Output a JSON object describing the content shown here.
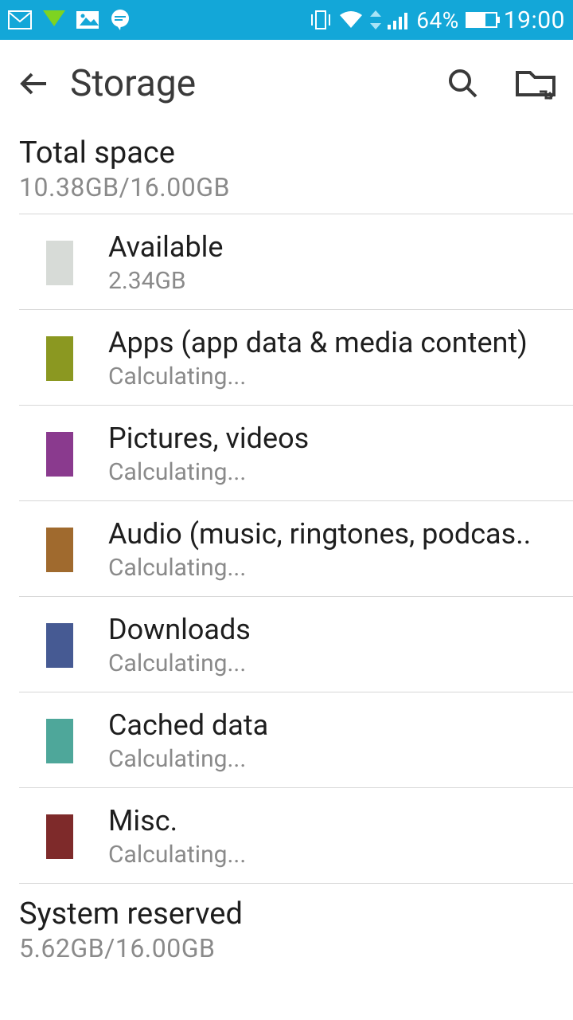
{
  "status": {
    "battery_pct": "64%",
    "time": "19:00"
  },
  "header": {
    "title": "Storage"
  },
  "total": {
    "label": "Total space",
    "value": "10.38GB/16.00GB"
  },
  "rows": [
    {
      "name": "available",
      "color": "#d7dbd7",
      "title": "Available",
      "sub": "2.34GB"
    },
    {
      "name": "apps",
      "color": "#8b9821",
      "title": "Apps (app data & media content)",
      "sub": "Calculating..."
    },
    {
      "name": "pictures",
      "color": "#8a3a8e",
      "title": "Pictures, videos",
      "sub": "Calculating..."
    },
    {
      "name": "audio",
      "color": "#a06a2e",
      "title": "Audio (music, ringtones, podcas..",
      "sub": "Calculating..."
    },
    {
      "name": "downloads",
      "color": "#465a93",
      "title": "Downloads",
      "sub": "Calculating..."
    },
    {
      "name": "cached",
      "color": "#4ea79a",
      "title": "Cached data",
      "sub": "Calculating..."
    },
    {
      "name": "misc",
      "color": "#7e2a2a",
      "title": "Misc.",
      "sub": "Calculating..."
    }
  ],
  "system": {
    "label": "System reserved",
    "value": "5.62GB/16.00GB"
  }
}
